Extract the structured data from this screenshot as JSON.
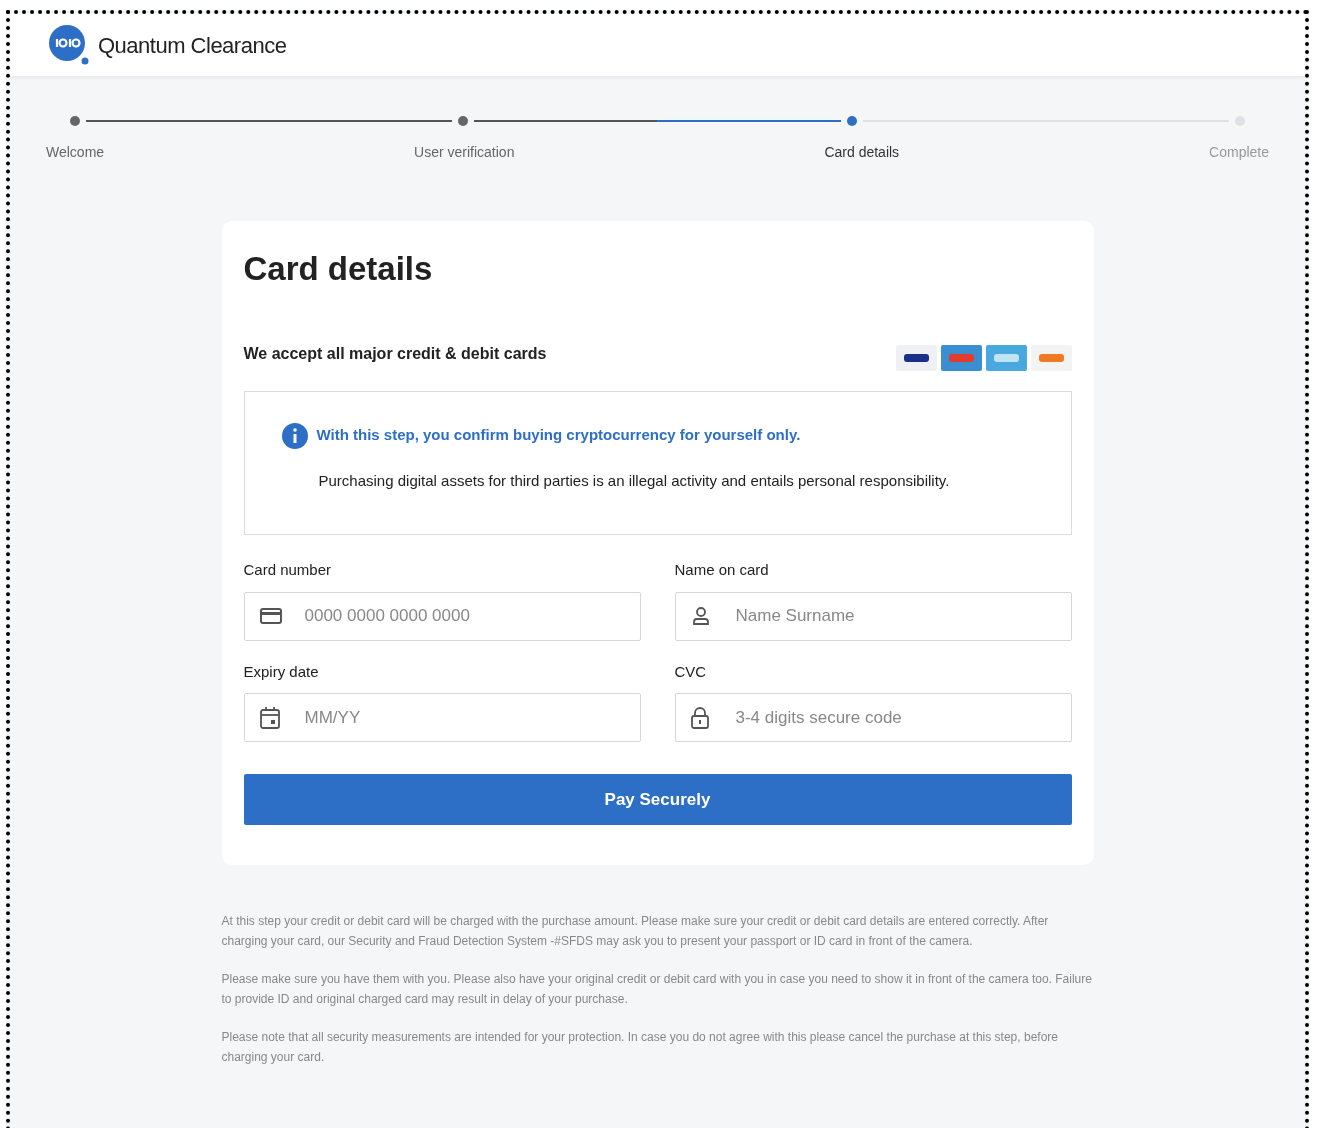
{
  "brand": {
    "name": "Quantum Clearance"
  },
  "steps": [
    {
      "label": "Welcome",
      "completed": true,
      "selected": false
    },
    {
      "label": "User verification",
      "completed": true,
      "selected": false
    },
    {
      "label": "Card details",
      "completed": false,
      "selected": true
    },
    {
      "label": "Complete",
      "completed": false,
      "selected": false
    }
  ],
  "card": {
    "title": "Card details",
    "subtitle": "We accept all major credit & debit cards",
    "notice": {
      "heading": "With this step, you confirm buying cryptocurrency for yourself only.",
      "text": "Purchasing digital assets for third parties is an illegal activity and entails personal responsibility."
    },
    "fields": [
      {
        "label": "Card number",
        "placeholder": "0000 0000 0000 0000",
        "kind": "card"
      },
      {
        "label": "Name on card",
        "placeholder": "Name Surname",
        "kind": "person"
      },
      {
        "label": "Expiry date",
        "placeholder": "MM/YY",
        "kind": "calendar"
      },
      {
        "label": "CVC",
        "placeholder": "3-4 digits secure code",
        "kind": "lock"
      }
    ],
    "button": "Pay Securely"
  },
  "notes": [
    "At this step your credit or debit card will be charged with the purchase amount. Please make sure your credit or debit card details are entered correctly. After charging your card, our Security and Fraud Detection System -#SFDS may ask you to present your passport or ID card in front of the camera.",
    "Please make sure you have them with you. Please also have your original credit or debit card with you in case you need to show it in front of the camera too. Failure to provide ID and original charged card may result in delay of your purchase.",
    "Please note that all security measurements are intended for your protection. In case you do not agree with this please cancel the purchase at this step, before charging your card."
  ]
}
